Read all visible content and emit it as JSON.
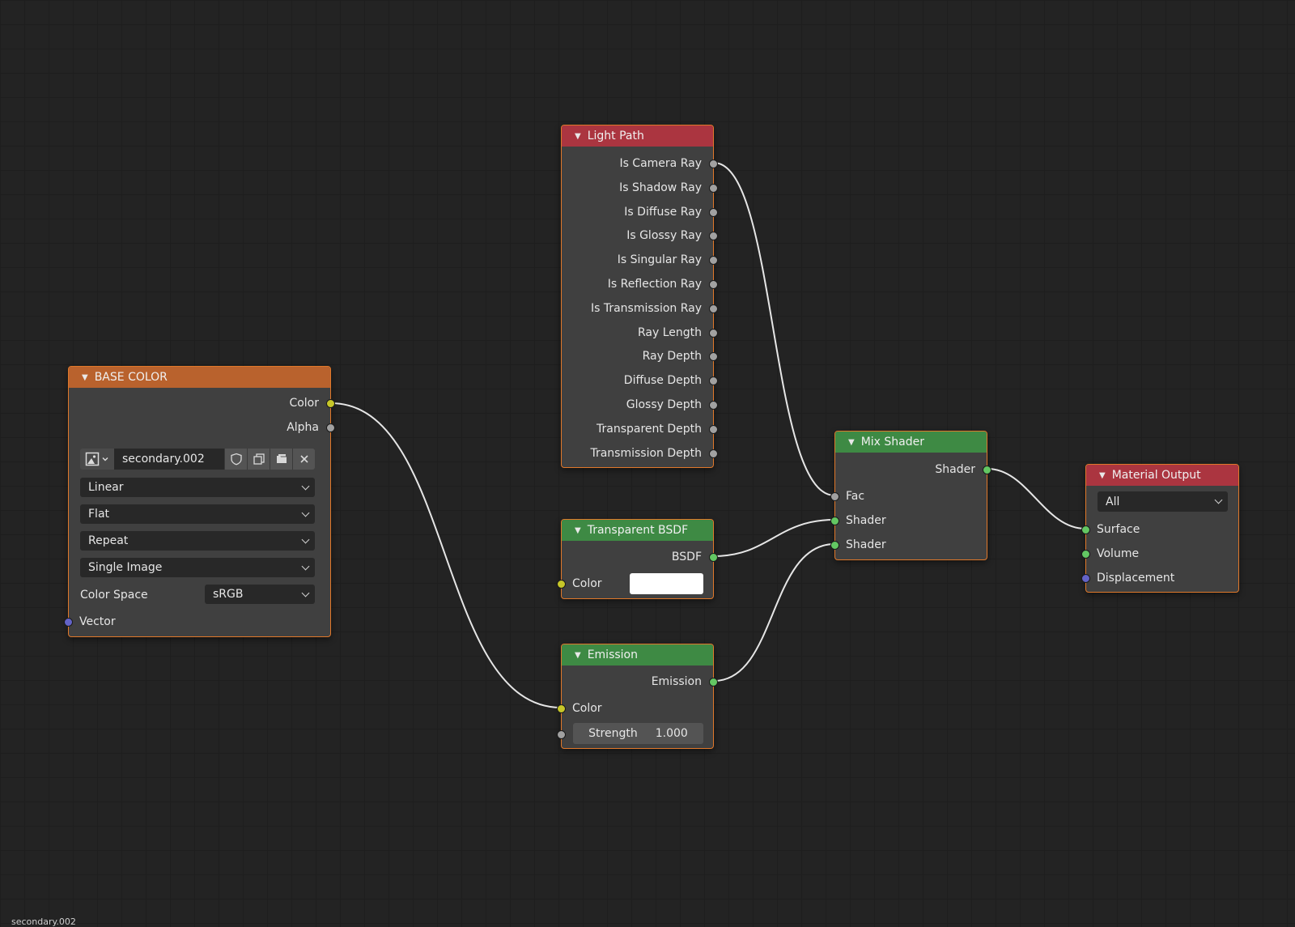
{
  "colors": {
    "texture_header": "#b9622d",
    "input_header": "#ab3540",
    "shader_header": "#3e8a44",
    "output_header": "#ab3540",
    "selected_border": "#e0782a",
    "link": "#e6e6e6"
  },
  "nodes": {
    "base_color": {
      "title": "BASE COLOR",
      "outputs": [
        "Color",
        "Alpha"
      ],
      "image": {
        "type_icon": "image-icon",
        "name": "secondary.002"
      },
      "interpolation": "Linear",
      "projection": "Flat",
      "extension": "Repeat",
      "source": "Single Image",
      "color_space_label": "Color Space",
      "color_space": "sRGB",
      "vector_label": "Vector"
    },
    "light_path": {
      "title": "Light Path",
      "outputs": [
        "Is Camera Ray",
        "Is Shadow Ray",
        "Is Diffuse Ray",
        "Is Glossy Ray",
        "Is Singular Ray",
        "Is Reflection Ray",
        "Is Transmission Ray",
        "Ray Length",
        "Ray Depth",
        "Diffuse Depth",
        "Glossy Depth",
        "Transparent Depth",
        "Transmission Depth"
      ]
    },
    "transparent_bsdf": {
      "title": "Transparent BSDF",
      "output": "BSDF",
      "color_label": "Color",
      "color_value": "#ffffff"
    },
    "emission": {
      "title": "Emission",
      "output": "Emission",
      "color_label": "Color",
      "strength_label": "Strength",
      "strength_value": "1.000"
    },
    "mix_shader": {
      "title": "Mix Shader",
      "output": "Shader",
      "fac_label": "Fac",
      "shader1_label": "Shader",
      "shader2_label": "Shader"
    },
    "material_output": {
      "title": "Material Output",
      "target": "All",
      "surface_label": "Surface",
      "volume_label": "Volume",
      "displacement_label": "Displacement"
    }
  },
  "footer_text": "secondary.002"
}
